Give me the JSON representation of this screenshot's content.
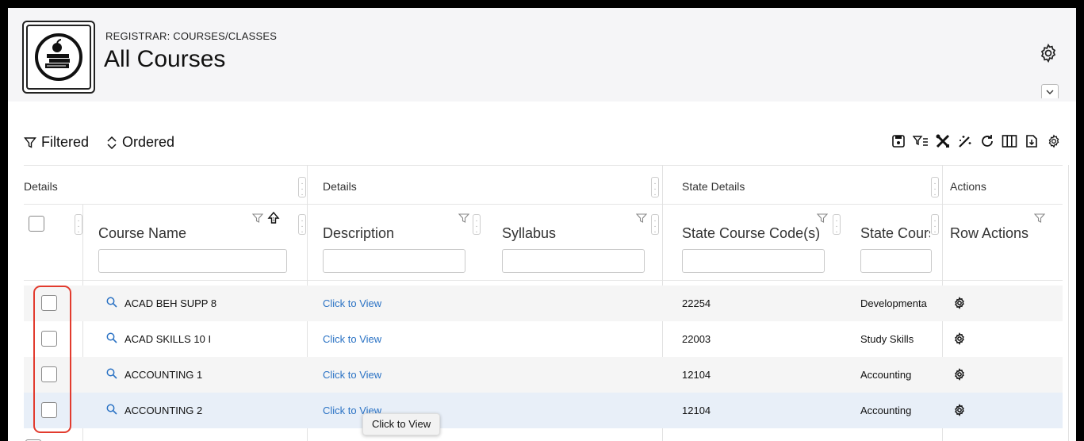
{
  "header": {
    "breadcrumb": "REGISTRAR: COURSES/CLASSES",
    "title": "All Courses"
  },
  "toolbar": {
    "filtered_label": "Filtered",
    "ordered_label": "Ordered",
    "icons": [
      "save-icon",
      "filter-list-icon",
      "tools-icon",
      "magic-wand-icon",
      "refresh-icon",
      "columns-icon",
      "export-icon",
      "gear-icon"
    ]
  },
  "grid": {
    "groups": [
      "Details",
      "Details",
      "State Details",
      "Actions"
    ],
    "columns": [
      "Course Name",
      "Description",
      "Syllabus",
      "State Course Code(s)",
      "State Cours",
      "Row Actions"
    ],
    "rows": [
      {
        "course_name": "ACAD BEH SUPP 8",
        "description": "Click to View",
        "syllabus": "",
        "state_code": "22254",
        "state_course": "Developmenta"
      },
      {
        "course_name": "ACAD SKILLS 10 I",
        "description": "Click to View",
        "syllabus": "",
        "state_code": "22003",
        "state_course": "Study Skills"
      },
      {
        "course_name": "ACCOUNTING 1",
        "description": "Click to View",
        "syllabus": "",
        "state_code": "12104",
        "state_course": "Accounting"
      },
      {
        "course_name": "ACCOUNTING 2",
        "description": "Click to View",
        "syllabus": "",
        "state_code": "12104",
        "state_course": "Accounting"
      }
    ]
  },
  "tooltip": "Click to View",
  "colors": {
    "link": "#2a72c4",
    "highlight": "#e23b2e",
    "selected_row": "#e8eff8",
    "header_bg": "#f5f5f7"
  }
}
